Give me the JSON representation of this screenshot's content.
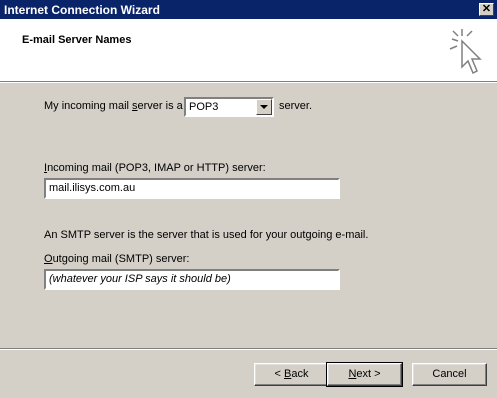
{
  "window": {
    "title": "Internet Connection Wizard",
    "close_glyph": "✕"
  },
  "header": {
    "title": "E-mail Server Names",
    "icon": "wizard-wand-icon"
  },
  "incoming_type": {
    "label_prefix_before": "My incoming mail ",
    "label_accel": "s",
    "label_prefix_after": "erver is a",
    "selected": "POP3",
    "label_suffix": "server."
  },
  "incoming_server": {
    "label_accel": "I",
    "label_rest": "ncoming mail (POP3, IMAP or HTTP) server:",
    "value": "mail.ilisys.com.au"
  },
  "smtp_info": "An SMTP server is the server that is used for your outgoing e-mail.",
  "outgoing_server": {
    "label_accel": "O",
    "label_rest": "utgoing mail (SMTP) server:",
    "value": "(whatever your ISP says it should be)"
  },
  "buttons": {
    "back_prefix": "< ",
    "back_accel": "B",
    "back_rest": "ack",
    "next_accel": "N",
    "next_rest": "ext >",
    "cancel": "Cancel"
  }
}
